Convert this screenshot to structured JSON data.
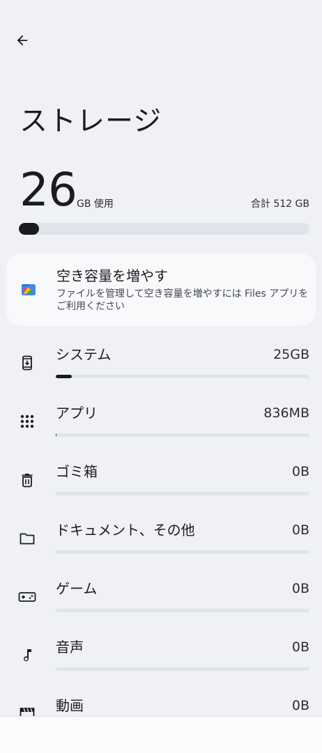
{
  "header": {
    "back_icon": "arrow-back-icon"
  },
  "page": {
    "title": "ストレージ"
  },
  "usage": {
    "used": "26",
    "unit": "GB 使用",
    "total": "合計 512 GB",
    "fraction": 0.069
  },
  "promo": {
    "icon": "files-app-icon",
    "title": "空き容量を増やす",
    "description": "ファイルを管理して空き容量を増やすには Files アプリをご利用ください"
  },
  "categories": [
    {
      "icon": "phone-system-icon",
      "label": "システム",
      "size": "25GB",
      "fraction": 0.062
    },
    {
      "icon": "apps-grid-icon",
      "label": "アプリ",
      "size": "836MB",
      "fraction": 0.002
    },
    {
      "icon": "trash-icon",
      "label": "ゴミ箱",
      "size": "0B",
      "fraction": 0
    },
    {
      "icon": "folder-icon",
      "label": "ドキュメント、その他",
      "size": "0B",
      "fraction": 0
    },
    {
      "icon": "gamepad-icon",
      "label": "ゲーム",
      "size": "0B",
      "fraction": 0
    },
    {
      "icon": "music-note-icon",
      "label": "音声",
      "size": "0B",
      "fraction": 0
    },
    {
      "icon": "movie-icon",
      "label": "動画",
      "size": "0B",
      "fraction": 0
    }
  ]
}
